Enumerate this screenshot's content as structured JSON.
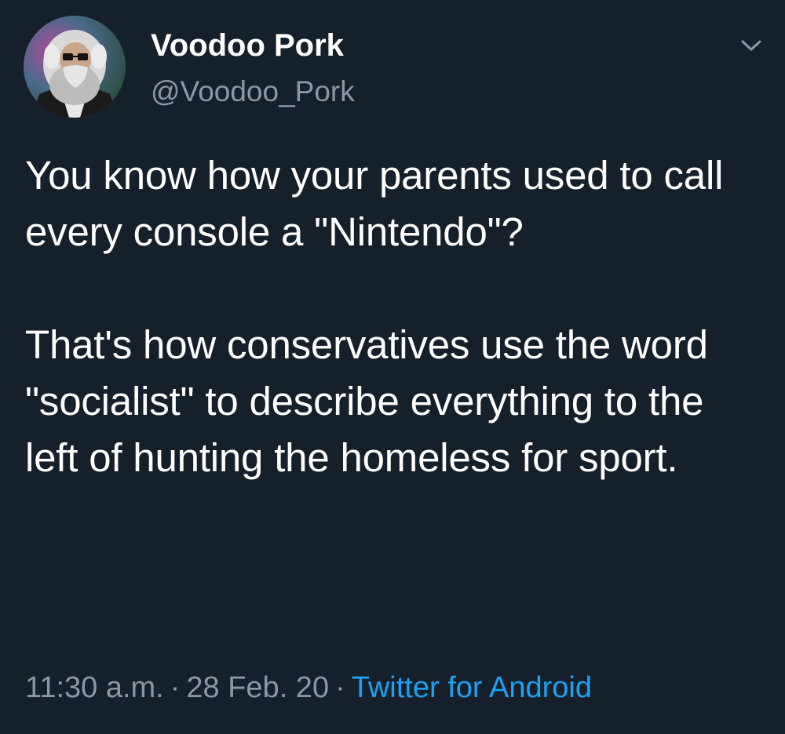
{
  "user": {
    "display_name": "Voodoo Pork",
    "handle": "@Voodoo_Pork",
    "avatar_icon": "avatar-portrait"
  },
  "tweet": {
    "paragraphs": [
      "You know how your parents used to call every console a \"Nintendo\"?",
      "That's how conservatives use the word \"socialist\" to describe everything to the left of hunting the homeless for sport."
    ]
  },
  "meta": {
    "time": "11:30 a.m.",
    "separator": "·",
    "date": "28 Feb. 20",
    "source": "Twitter for Android"
  },
  "colors": {
    "background": "#15202b",
    "text": "#ffffff",
    "secondary": "#8899a6",
    "link": "#1da1f2"
  },
  "icons": {
    "menu": "chevron-down-icon"
  }
}
